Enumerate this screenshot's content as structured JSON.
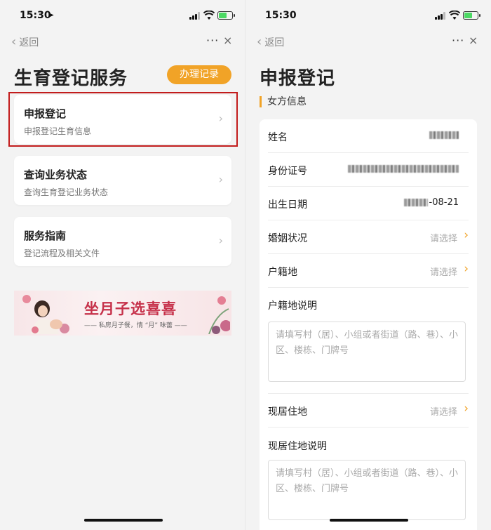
{
  "status_bar": {
    "time": "15:30"
  },
  "nav": {
    "back_label": "返回",
    "more": "···",
    "close": "×"
  },
  "left_screen": {
    "page_title": "生育登记服务",
    "records_button": "办理记录",
    "cards": [
      {
        "title": "申报登记",
        "subtitle": "申报登记生育信息"
      },
      {
        "title": "查询业务状态",
        "subtitle": "查询生育登记业务状态"
      },
      {
        "title": "服务指南",
        "subtitle": "登记流程及相关文件"
      }
    ],
    "banner": {
      "headline": "坐月子选喜喜",
      "tagline": "—— 私房月子餐，情 “月” 味蕾 ——"
    }
  },
  "right_screen": {
    "page_title": "申报登记",
    "section_label": "女方信息",
    "fields": {
      "name": {
        "label": "姓名"
      },
      "id_number": {
        "label": "身份证号"
      },
      "birth_date": {
        "label": "出生日期",
        "value_suffix": "-08-21"
      },
      "marital_status": {
        "label": "婚姻状况",
        "placeholder": "请选择"
      },
      "household_registration": {
        "label": "户籍地",
        "placeholder": "请选择"
      },
      "household_registration_note": {
        "label": "户籍地说明",
        "placeholder": "请填写村（居）、小组或者街道（路、巷）、小区、楼栋、门牌号"
      },
      "residence": {
        "label": "现居住地",
        "placeholder": "请选择"
      },
      "residence_note": {
        "label": "现居住地说明",
        "placeholder": "请填写村（居）、小组或者街道（路、巷）、小区、楼栋、门牌号"
      }
    }
  },
  "colors": {
    "accent": "#f1a327",
    "highlight_border": "#c21c1c",
    "banner_text": "#c6314a"
  }
}
